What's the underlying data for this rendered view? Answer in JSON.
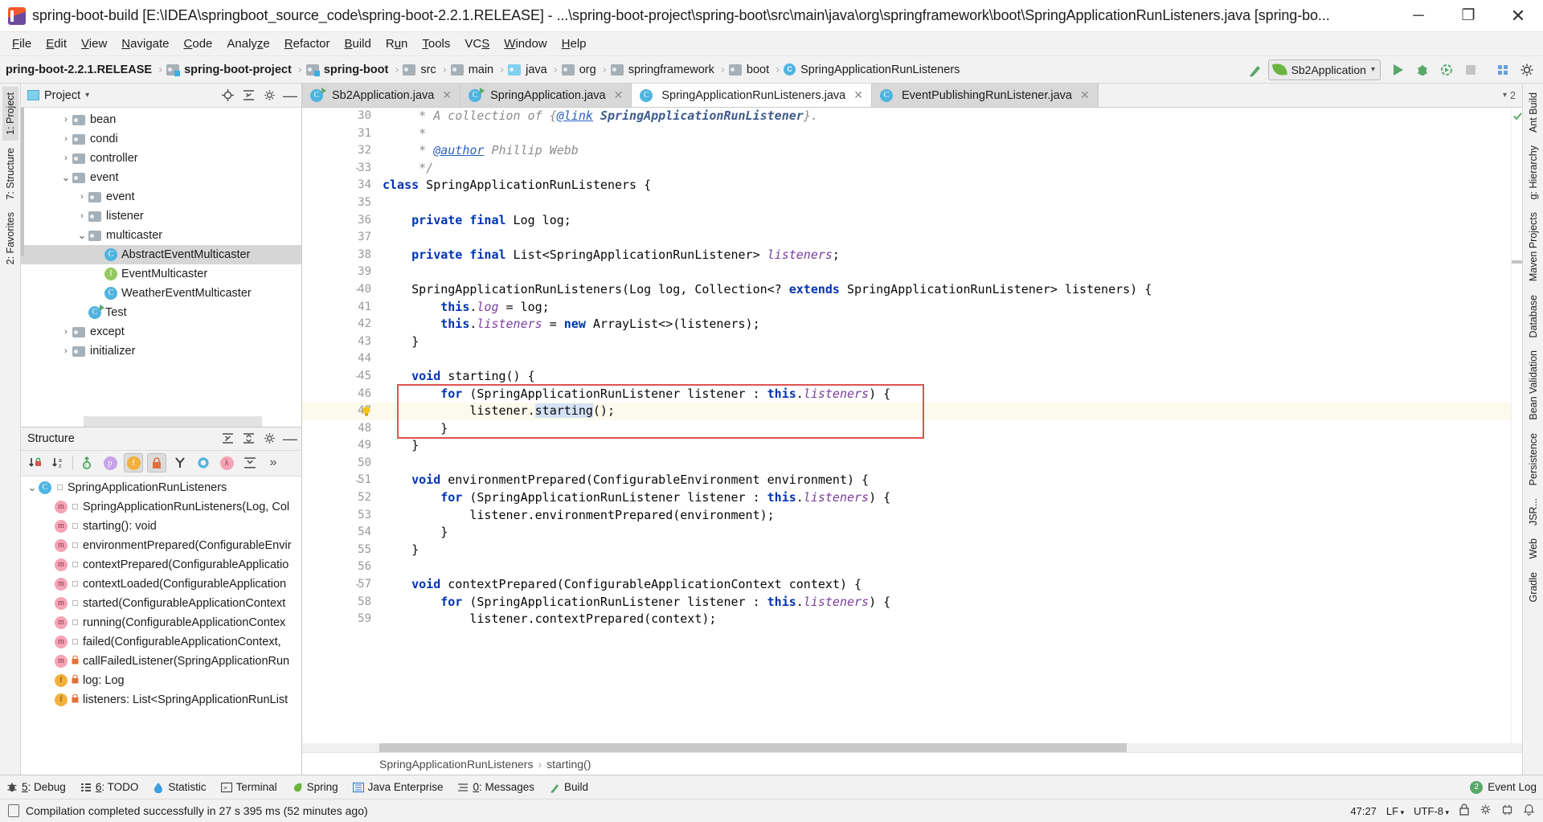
{
  "window": {
    "title": "spring-boot-build [E:\\IDEA\\springboot_source_code\\spring-boot-2.2.1.RELEASE] - ...\\spring-boot-project\\spring-boot\\src\\main\\java\\org\\springframework\\boot\\SpringApplicationRunListeners.java [spring-bo...",
    "minimize": "─",
    "maximize": "❐",
    "close": "✕"
  },
  "menu": [
    {
      "label": "File",
      "accel": "F"
    },
    {
      "label": "Edit",
      "accel": "E"
    },
    {
      "label": "View",
      "accel": "V"
    },
    {
      "label": "Navigate",
      "accel": "N"
    },
    {
      "label": "Code",
      "accel": "C"
    },
    {
      "label": "Analyze",
      "accel": "z"
    },
    {
      "label": "Refactor",
      "accel": "R"
    },
    {
      "label": "Build",
      "accel": "B"
    },
    {
      "label": "Run",
      "accel": "u"
    },
    {
      "label": "Tools",
      "accel": "T"
    },
    {
      "label": "VCS",
      "accel": "S"
    },
    {
      "label": "Window",
      "accel": "W"
    },
    {
      "label": "Help",
      "accel": "H"
    }
  ],
  "navbar": {
    "crumbs": [
      {
        "label": "pring-boot-2.2.1.RELEASE",
        "icon": "none",
        "bold": true
      },
      {
        "label": "spring-boot-project",
        "icon": "module-folder",
        "bold": true
      },
      {
        "label": "spring-boot",
        "icon": "module-folder",
        "bold": true
      },
      {
        "label": "src",
        "icon": "folder",
        "bold": false
      },
      {
        "label": "main",
        "icon": "folder",
        "bold": false
      },
      {
        "label": "java",
        "icon": "source-folder",
        "bold": false
      },
      {
        "label": "org",
        "icon": "package-folder",
        "bold": false
      },
      {
        "label": "springframework",
        "icon": "package-folder",
        "bold": false
      },
      {
        "label": "boot",
        "icon": "package-folder",
        "bold": false
      },
      {
        "label": "SpringApplicationRunListeners",
        "icon": "class",
        "bold": false
      }
    ],
    "separator": "›",
    "run_config": "Sb2Application",
    "run_config_chevron": "▾",
    "buttons": [
      "build-icon",
      "run-icon",
      "debug-icon",
      "run-coverage-icon",
      "stop-icon",
      "search-everywhere-icon",
      "settings-icon"
    ]
  },
  "project_panel": {
    "title": "Project",
    "title_chevron": "▾",
    "header_icons": [
      "locate-icon",
      "collapse-all-icon",
      "gear-icon",
      "hide-icon"
    ],
    "rows": [
      {
        "indent": 2,
        "arrow": "›",
        "icon": "folder",
        "label": "bean",
        "selected": false
      },
      {
        "indent": 2,
        "arrow": "›",
        "icon": "folder",
        "label": "condi",
        "selected": false
      },
      {
        "indent": 2,
        "arrow": "›",
        "icon": "folder",
        "label": "controller",
        "selected": false
      },
      {
        "indent": 2,
        "arrow": "⌄",
        "icon": "folder",
        "label": "event",
        "selected": false
      },
      {
        "indent": 3,
        "arrow": "›",
        "icon": "folder",
        "label": "event",
        "selected": false
      },
      {
        "indent": 3,
        "arrow": "›",
        "icon": "folder",
        "label": "listener",
        "selected": false
      },
      {
        "indent": 3,
        "arrow": "⌄",
        "icon": "folder",
        "label": "multicaster",
        "selected": false
      },
      {
        "indent": 4,
        "arrow": "",
        "icon": "class",
        "label": "AbstractEventMulticaster",
        "selected": true
      },
      {
        "indent": 4,
        "arrow": "",
        "icon": "interface",
        "label": "EventMulticaster",
        "selected": false
      },
      {
        "indent": 4,
        "arrow": "",
        "icon": "class",
        "label": "WeatherEventMulticaster",
        "selected": false
      },
      {
        "indent": 3,
        "arrow": "",
        "icon": "class-runnable",
        "label": "Test",
        "selected": false
      },
      {
        "indent": 2,
        "arrow": "›",
        "icon": "folder",
        "label": "except",
        "selected": false
      },
      {
        "indent": 2,
        "arrow": "›",
        "icon": "folder",
        "label": "initializer",
        "selected": false
      }
    ]
  },
  "structure_panel": {
    "title": "Structure",
    "header_icons": [
      "expand-all-icon",
      "collapse-all-icon",
      "gear-icon",
      "hide-icon"
    ],
    "toolbar_icons": [
      "sort-by-visibility-icon",
      "sort-alphabetically-icon",
      "show-inherited-icon",
      "show-properties-icon",
      "show-fields-icon",
      "show-non-public-icon",
      "show-anonymous-icon",
      "show-interfaces-icon",
      "show-lambdas-icon",
      "expand-icon",
      "more-icon"
    ],
    "more": "»",
    "rows": [
      {
        "indent": 0,
        "arrow": "⌄",
        "icon": "class",
        "label": "SpringApplicationRunListeners",
        "lock": ""
      },
      {
        "indent": 1,
        "arrow": "",
        "icon": "method",
        "label": "SpringApplicationRunListeners(Log, Col",
        "lock": ""
      },
      {
        "indent": 1,
        "arrow": "",
        "icon": "method",
        "label": "starting(): void",
        "lock": ""
      },
      {
        "indent": 1,
        "arrow": "",
        "icon": "method",
        "label": "environmentPrepared(ConfigurableEnvir",
        "lock": ""
      },
      {
        "indent": 1,
        "arrow": "",
        "icon": "method",
        "label": "contextPrepared(ConfigurableApplicatio",
        "lock": ""
      },
      {
        "indent": 1,
        "arrow": "",
        "icon": "method",
        "label": "contextLoaded(ConfigurableApplication",
        "lock": ""
      },
      {
        "indent": 1,
        "arrow": "",
        "icon": "method",
        "label": "started(ConfigurableApplicationContext",
        "lock": ""
      },
      {
        "indent": 1,
        "arrow": "",
        "icon": "method",
        "label": "running(ConfigurableApplicationContex",
        "lock": ""
      },
      {
        "indent": 1,
        "arrow": "",
        "icon": "method",
        "label": "failed(ConfigurableApplicationContext,",
        "lock": ""
      },
      {
        "indent": 1,
        "arrow": "",
        "icon": "method",
        "label": "callFailedListener(SpringApplicationRun",
        "lock": "🔒"
      },
      {
        "indent": 1,
        "arrow": "",
        "icon": "field",
        "label": "log: Log",
        "lock": "🔒"
      },
      {
        "indent": 1,
        "arrow": "",
        "icon": "field",
        "label": "listeners: List<SpringApplicationRunList",
        "lock": "🔒"
      }
    ]
  },
  "left_strip": [
    {
      "label": "1: Project",
      "selected": true
    },
    {
      "label": "7: Structure",
      "selected": false
    },
    {
      "label": "2: Favorites",
      "selected": false
    }
  ],
  "right_strip": [
    {
      "label": "Ant Build"
    },
    {
      "label": "g: Hierarchy"
    },
    {
      "label": "Maven Projects"
    },
    {
      "label": "Database"
    },
    {
      "label": "Bean Validation"
    },
    {
      "label": "Persistence"
    },
    {
      "label": "JSR..."
    },
    {
      "label": "Web"
    },
    {
      "label": "Gradle"
    }
  ],
  "editor_tabs": [
    {
      "label": "Sb2Application.java",
      "icon": "class-runnable",
      "active": false
    },
    {
      "label": "SpringApplication.java",
      "icon": "class-runnable",
      "active": false
    },
    {
      "label": "SpringApplicationRunListeners.java",
      "icon": "class",
      "active": true
    },
    {
      "label": "EventPublishingRunListener.java",
      "icon": "class",
      "active": false
    }
  ],
  "editor_tabs_overflow": "2",
  "code": {
    "first_line": 30,
    "lines": [
      {
        "n": 30,
        "fold": "",
        "html": "     <span class='cm'>* A collection of {</span><span class='cmlink'>@link</span><span class='cmb'> SpringApplicationRunListener</span><span class='cm'>}.</span>"
      },
      {
        "n": 31,
        "fold": "",
        "html": "     <span class='cm'>*</span>"
      },
      {
        "n": 32,
        "fold": "",
        "html": "     <span class='cm'>* </span><span class='cmlink'>@author</span><span class='cm'> Phillip Webb</span>"
      },
      {
        "n": 33,
        "fold": "⌄",
        "html": "     <span class='cm'>*/</span>"
      },
      {
        "n": 34,
        "fold": "",
        "html": "<span class='kw'>class</span> SpringApplicationRunListeners {"
      },
      {
        "n": 35,
        "fold": "",
        "html": ""
      },
      {
        "n": 36,
        "fold": "",
        "html": "    <span class='kw'>private final</span> Log log;"
      },
      {
        "n": 37,
        "fold": "",
        "html": ""
      },
      {
        "n": 38,
        "fold": "",
        "html": "    <span class='kw'>private final</span> List&lt;SpringApplicationRunListener&gt; <span class='fld'>listeners</span>;"
      },
      {
        "n": 39,
        "fold": "",
        "html": ""
      },
      {
        "n": 40,
        "fold": "⌄",
        "html": "    SpringApplicationRunListeners(Log log, Collection&lt;? <span class='kw'>extends</span> SpringApplicationRunListener&gt; listeners) {"
      },
      {
        "n": 41,
        "fold": "",
        "html": "        <span class='kw'>this</span>.<span class='fld'>log</span> = log;"
      },
      {
        "n": 42,
        "fold": "",
        "html": "        <span class='kw'>this</span>.<span class='fld'>listeners</span> = <span class='kw'>new</span> ArrayList&lt;&gt;(listeners);"
      },
      {
        "n": 43,
        "fold": "",
        "html": "    }"
      },
      {
        "n": 44,
        "fold": "",
        "html": ""
      },
      {
        "n": 45,
        "fold": "⌄",
        "html": "    <span class='kw'>void</span> starting() {"
      },
      {
        "n": 46,
        "fold": "",
        "html": "        <span class='kw'>for</span> (SpringApplicationRunListener listener : <span class='kw'>this</span>.<span class='fld'>listeners</span>) {"
      },
      {
        "n": 47,
        "fold": "",
        "html": "            listener.<span class='caret-sel'>starting</span>();"
      },
      {
        "n": 48,
        "fold": "",
        "html": "        }"
      },
      {
        "n": 49,
        "fold": "",
        "html": "    }"
      },
      {
        "n": 50,
        "fold": "",
        "html": ""
      },
      {
        "n": 51,
        "fold": "⌄",
        "html": "    <span class='kw'>void</span> environmentPrepared(ConfigurableEnvironment environment) {"
      },
      {
        "n": 52,
        "fold": "",
        "html": "        <span class='kw'>for</span> (SpringApplicationRunListener listener : <span class='kw'>this</span>.<span class='fld'>listeners</span>) {"
      },
      {
        "n": 53,
        "fold": "",
        "html": "            listener.environmentPrepared(environment);"
      },
      {
        "n": 54,
        "fold": "",
        "html": "        }"
      },
      {
        "n": 55,
        "fold": "",
        "html": "    }"
      },
      {
        "n": 56,
        "fold": "",
        "html": ""
      },
      {
        "n": 57,
        "fold": "⌄",
        "html": "    <span class='kw'>void</span> contextPrepared(ConfigurableApplicationContext context) {"
      },
      {
        "n": 58,
        "fold": "",
        "html": "        <span class='kw'>for</span> (SpringApplicationRunListener listener : <span class='kw'>this</span>.<span class='fld'>listeners</span>) {"
      },
      {
        "n": 59,
        "fold": "",
        "html": "            listener.contextPrepared(context);"
      }
    ],
    "highlight_line": 47,
    "bulb_line": 47,
    "red_box_start_line": 46,
    "red_box_end_line": 48
  },
  "editor_breadcrumb": {
    "items": [
      "SpringApplicationRunListeners",
      "starting()"
    ],
    "separator": "›"
  },
  "bottom_bar": {
    "items": [
      {
        "label": "5: Debug",
        "accel": "5",
        "icon": "debug-icon"
      },
      {
        "label": "6: TODO",
        "accel": "6",
        "icon": "todo-icon"
      },
      {
        "label": "Statistic",
        "accel": "",
        "icon": "statistic-icon"
      },
      {
        "label": "Terminal",
        "accel": "",
        "icon": "terminal-icon"
      },
      {
        "label": "Spring",
        "accel": "",
        "icon": "spring-icon"
      },
      {
        "label": "Java Enterprise",
        "accel": "",
        "icon": "java-enterprise-icon"
      },
      {
        "label": "0: Messages",
        "accel": "0",
        "icon": "messages-icon"
      },
      {
        "label": "Build",
        "accel": "",
        "icon": "build-icon"
      }
    ],
    "event_log": "Event Log",
    "event_count": "2"
  },
  "status_bar": {
    "message": "Compilation completed successfully in 27 s 395 ms (52 minutes ago)",
    "caret": "47:27",
    "line_sep": "LF",
    "encoding": "UTF-8",
    "chevron": "▾",
    "icons": [
      "lock-icon",
      "inspection-icon",
      "memory-icon",
      "notifications-icon"
    ]
  },
  "colors": {
    "accent_blue": "#4eb4e0",
    "error_red": "#e05252",
    "green": "#59a869",
    "highlight_bg": "#fcfaed",
    "selection": "#d6d6d6"
  }
}
